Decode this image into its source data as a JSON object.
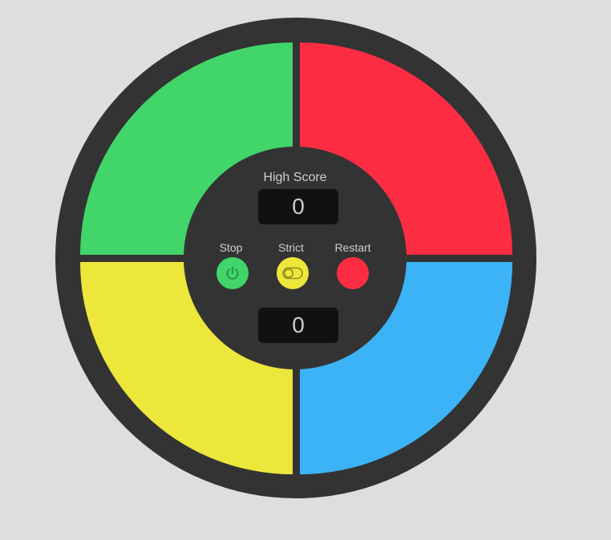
{
  "colors": {
    "background": "#dedede",
    "ring": "#333333",
    "green": "#41d56a",
    "red": "#fc2d43",
    "yellow": "#ede73c",
    "blue": "#3cb3f6",
    "display_bg": "#111111"
  },
  "pads": [
    {
      "id": "green",
      "color": "#41d56a"
    },
    {
      "id": "red",
      "color": "#fc2d43"
    },
    {
      "id": "yellow",
      "color": "#ede73c"
    },
    {
      "id": "blue",
      "color": "#3cb3f6"
    }
  ],
  "center": {
    "high_score_label": "High Score",
    "high_score_value": "0",
    "count_value": "0"
  },
  "controls": {
    "stop": {
      "label": "Stop",
      "icon": "power-icon",
      "color": "#41d56a"
    },
    "strict": {
      "label": "Strict",
      "icon": "toggle-icon",
      "color": "#ede73c"
    },
    "restart": {
      "label": "Restart",
      "icon": "none",
      "color": "#fc2d43"
    }
  }
}
